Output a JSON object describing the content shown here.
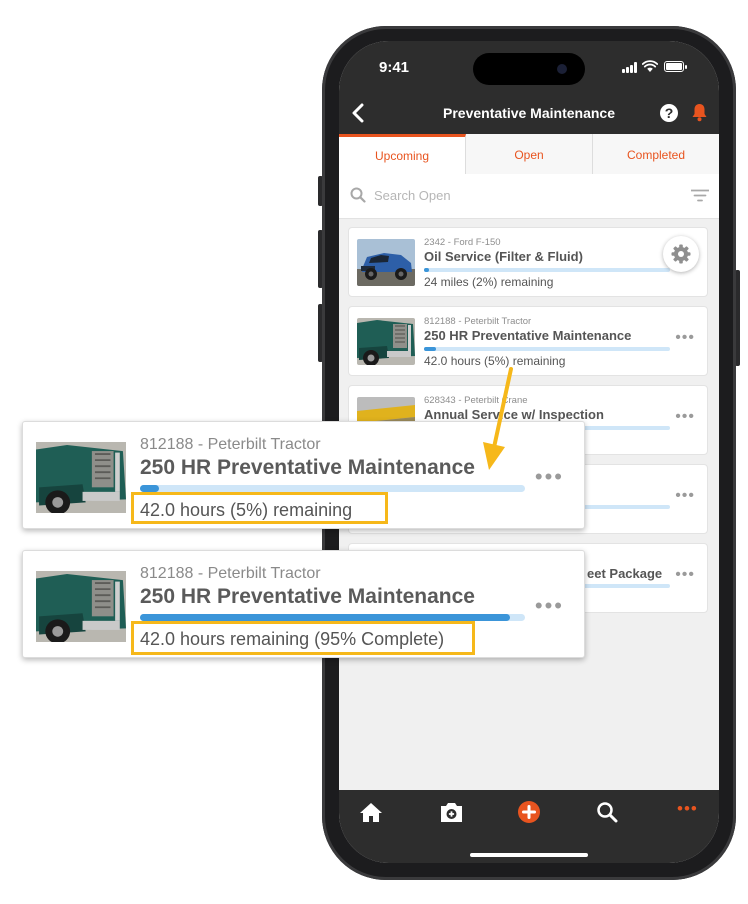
{
  "status_bar": {
    "time": "9:41"
  },
  "app_bar": {
    "title": "Preventative Maintenance",
    "back_icon": "chevron-left-icon",
    "help_icon": "help-circle-icon",
    "bell_icon": "bell-icon"
  },
  "tabs": [
    {
      "label": "Upcoming",
      "active": true
    },
    {
      "label": "Open",
      "active": false
    },
    {
      "label": "Completed",
      "active": false
    }
  ],
  "search": {
    "placeholder": "Search Open",
    "search_icon": "search-icon",
    "filter_icon": "filter-icon"
  },
  "cards": [
    {
      "subtitle": "2342 - Ford F-150",
      "title": "Oil Service (Filter & Fluid)",
      "remaining": "24 miles (2%) remaining",
      "progress": 0.02
    },
    {
      "subtitle": "812188 - Peterbilt Tractor",
      "title": "250 HR Preventative Maintenance",
      "remaining": "42.0 hours (5%) remaining",
      "progress": 0.05
    },
    {
      "subtitle": "628343 - Peterbilt Crane",
      "title": "Annual Service w/ Inspection",
      "remaining": "",
      "progress": 0.0
    },
    {
      "subtitle": "",
      "title": "",
      "remaining": "",
      "progress": 0.0
    },
    {
      "subtitle": "",
      "title": "eet Package",
      "remaining": "",
      "progress": 0.0
    }
  ],
  "callouts": [
    {
      "subtitle": "812188 - Peterbilt Tractor",
      "title": "250 HR Preventative Maintenance",
      "remaining": "42.0 hours (5%) remaining",
      "progress": 0.05
    },
    {
      "subtitle": "812188 - Peterbilt Tractor",
      "title": "250 HR Preventative Maintenance",
      "remaining": "42.0 hours remaining (95% Complete)",
      "progress": 0.96
    }
  ],
  "bottom_nav": [
    {
      "icon": "home-icon"
    },
    {
      "icon": "camera-add-icon"
    },
    {
      "icon": "add-circle-icon"
    },
    {
      "icon": "search-icon"
    },
    {
      "icon": "more-icon"
    }
  ],
  "colors": {
    "accent": "#e8541f",
    "bar_dark": "#2d2d2d",
    "progress": "#3b95d9",
    "highlight": "#f6b81a"
  }
}
